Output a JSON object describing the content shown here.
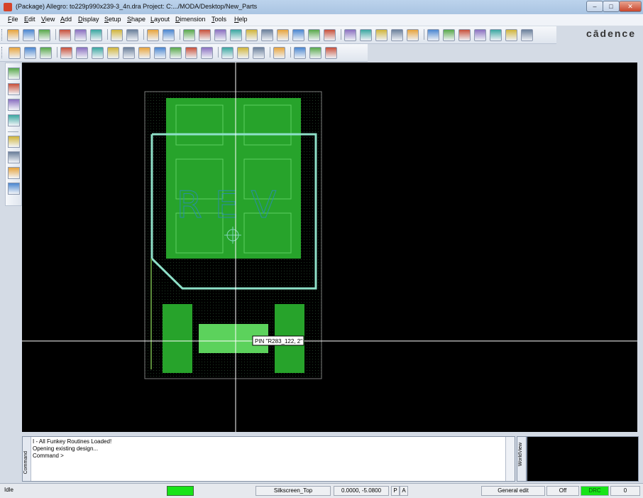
{
  "window": {
    "title": "(Package) Allegro: to229p990x239-3_4n.dra  Project: C:.../MODA/Desktop/New_Parts",
    "brand": "cādence"
  },
  "menu": [
    "File",
    "Edit",
    "View",
    "Add",
    "Display",
    "Setup",
    "Shape",
    "Layout",
    "Dimension",
    "Tools",
    "Help"
  ],
  "toolbar1_icons": [
    "new-icon",
    "open-icon",
    "save-icon",
    "sep",
    "move-icon",
    "copy-icon",
    "delete-icon",
    "sep",
    "undo-icon",
    "redo-icon",
    "sep",
    "fix-icon",
    "unfix-icon",
    "sep",
    "zoom-points-icon",
    "zoom-in-icon",
    "zoom-out-icon",
    "zoom-world-icon",
    "zoom-center-icon",
    "zoom-fit-icon",
    "zoom-previous-icon",
    "redraw-icon",
    "3d-view-icon",
    "color-icon",
    "sep",
    "grid-icon",
    "layer-icon",
    "shadow-icon",
    "stack-icon",
    "view-icon",
    "sep",
    "info-icon",
    "measure-icon",
    "properties-icon",
    "filter-icon",
    "show-icon",
    "ratsnest-icon",
    "print-icon"
  ],
  "toolbar2_icons": [
    "pin-icon",
    "via-icon",
    "shape-icon",
    "sep",
    "dimension-icon",
    "line-icon",
    "rect-icon",
    "circle-icon",
    "select-icon",
    "polygon-icon",
    "frame-icon",
    "square-icon",
    "round-icon",
    "screen-icon",
    "sep",
    "component-icon",
    "height-icon",
    "width-icon",
    "sep",
    "snapshot-icon",
    "sep",
    "window-icon",
    "report-icon",
    "help-icon"
  ],
  "lefttb_icons": [
    "pencil-icon",
    "pin-add-icon",
    "text-icon",
    "arrow-icon",
    "sep",
    "line-draw-icon",
    "rect-draw-icon",
    "text-add-icon",
    "text-edit-icon"
  ],
  "canvas": {
    "overlay_text": "REV",
    "tooltip": "PIN \"R283_122, 2\""
  },
  "console": {
    "tab_label": "Command",
    "lines": [
      "I - All Funkey Routines Loaded!",
      "Opening existing design...",
      "Command >"
    ]
  },
  "worldview": {
    "tab_label": "WorldView"
  },
  "status": {
    "state": "Idle",
    "layer": "Silkscreen_Top",
    "coords": "0.0000, -5.0800",
    "p": "P",
    "a": "A",
    "mode": "General edit",
    "off": "Off",
    "drc": "DRC",
    "count": "0"
  },
  "colors": {
    "pad_green": "#27a32b",
    "pad_light": "#5cd25c",
    "outline": "#8ee0c8",
    "cursor": "#ffffff",
    "drc_green": "#18e418"
  }
}
